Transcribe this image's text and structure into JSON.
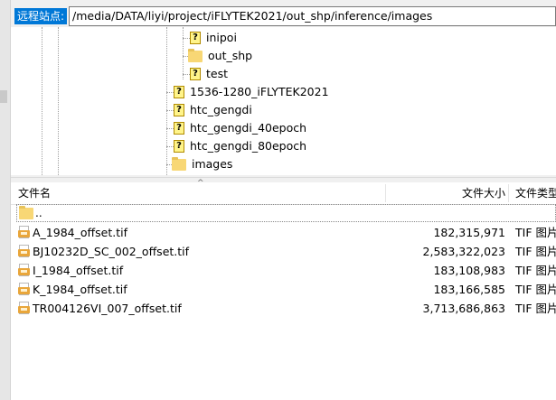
{
  "remote": {
    "label": "远程站点:",
    "path": "/media/DATA/liyi/project/iFLYTEK2021/out_shp/inference/images"
  },
  "tree": {
    "items": [
      {
        "label": "inipoi",
        "icon": "question-mark-icon"
      },
      {
        "label": "out_shp",
        "icon": "folder-icon"
      },
      {
        "label": "test",
        "icon": "question-mark-icon"
      },
      {
        "label": "1536-1280_iFLYTEK2021",
        "icon": "question-mark-icon"
      },
      {
        "label": "htc_gengdi",
        "icon": "question-mark-icon"
      },
      {
        "label": "htc_gengdi_40epoch",
        "icon": "question-mark-icon"
      },
      {
        "label": "htc_gengdi_80epoch",
        "icon": "question-mark-icon"
      },
      {
        "label": "images",
        "icon": "folder-icon",
        "selected": true
      }
    ]
  },
  "list": {
    "columns": {
      "name": "文件名",
      "size": "文件大小",
      "type": "文件类型"
    },
    "parent": "..",
    "files": [
      {
        "name": "A_1984_offset.tif",
        "size": "182,315,971",
        "type": "TIF 图片"
      },
      {
        "name": "BJ10232D_SC_002_offset.tif",
        "size": "2,583,322,023",
        "type": "TIF 图片"
      },
      {
        "name": "I_1984_offset.tif",
        "size": "183,108,983",
        "type": "TIF 图片"
      },
      {
        "name": "K_1984_offset.tif",
        "size": "183,166,585",
        "type": "TIF 图片"
      },
      {
        "name": "TR004126VI_007_offset.tif",
        "size": "3,713,686,863",
        "type": "TIF 图片"
      }
    ]
  },
  "colors": {
    "accent": "#0078d7",
    "folder": "#f8d775",
    "tif_badge": "#e9a63a"
  }
}
